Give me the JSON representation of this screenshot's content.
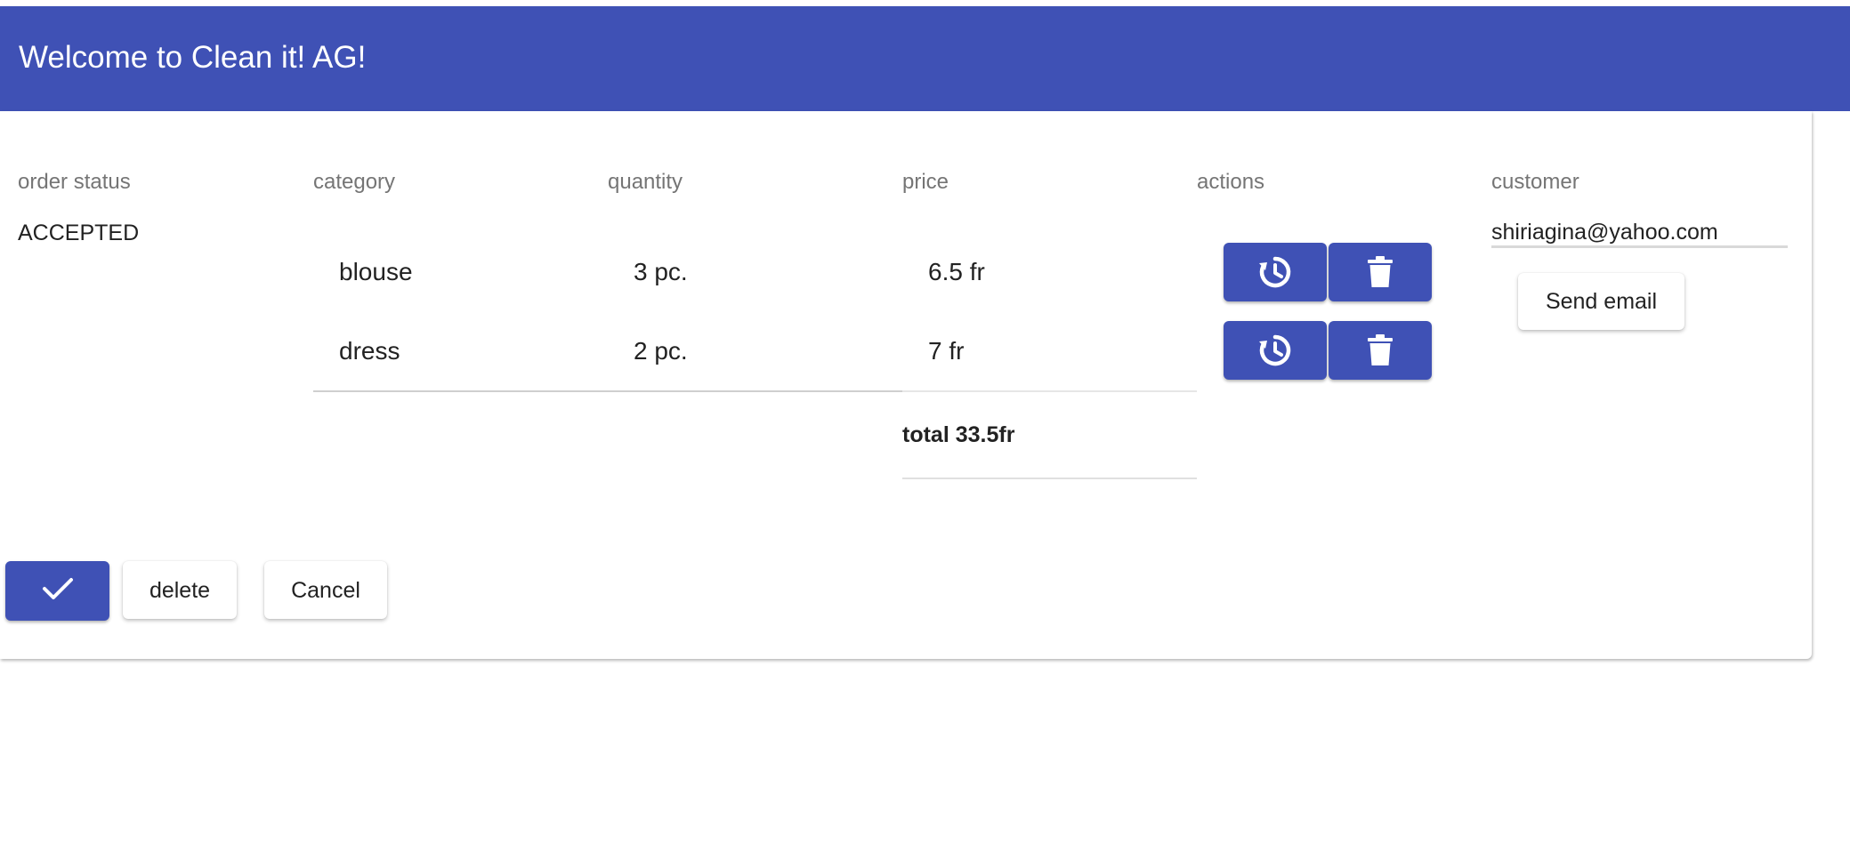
{
  "colors": {
    "primary": "#3f51b5",
    "header_text": "#ffffff"
  },
  "header": {
    "title": "Welcome to Clean it! AG!"
  },
  "table": {
    "columns": {
      "order_status": "order status",
      "category": "category",
      "quantity": "quantity",
      "price": "price",
      "actions": "actions",
      "customer": "customer"
    },
    "order_status": "ACCEPTED",
    "rows": [
      {
        "category": "blouse",
        "quantity": "3 pc.",
        "price": "6.5 fr",
        "actions": [
          "history-icon",
          "trash-icon"
        ]
      },
      {
        "category": "dress",
        "quantity": "2 pc.",
        "price": "7 fr",
        "actions": [
          "history-icon",
          "trash-icon"
        ]
      }
    ],
    "total": "total 33.5fr",
    "customer_email": "shiriagina@yahoo.com",
    "send_email_label": "Send email"
  },
  "footer_actions": {
    "confirm_icon": "check-icon",
    "delete_label": "delete",
    "cancel_label": "Cancel"
  }
}
